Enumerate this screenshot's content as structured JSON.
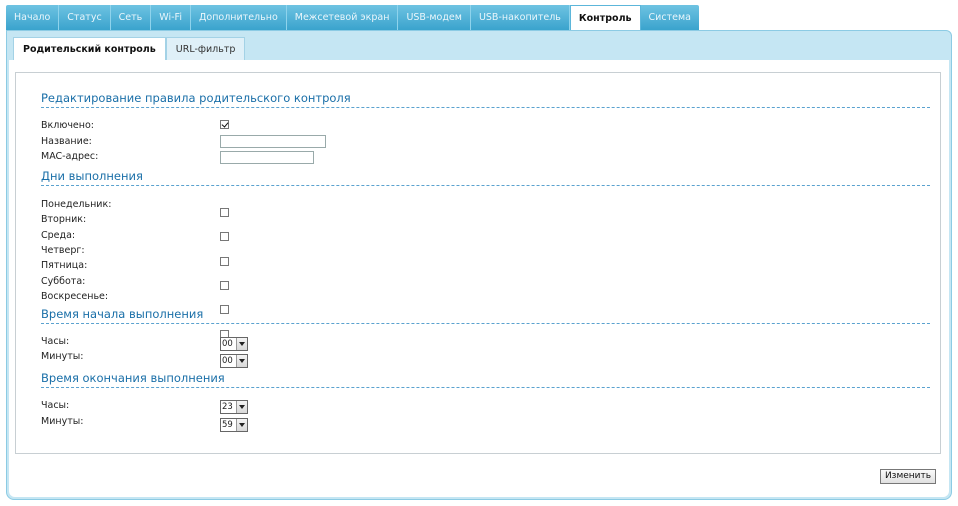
{
  "top_tabs": [
    {
      "label": "Начало"
    },
    {
      "label": "Статус"
    },
    {
      "label": "Сеть"
    },
    {
      "label": "Wi-Fi"
    },
    {
      "label": "Дополнительно"
    },
    {
      "label": "Межсетевой экран"
    },
    {
      "label": "USB-модем"
    },
    {
      "label": "USB-накопитель"
    },
    {
      "label": "Контроль"
    },
    {
      "label": "Система"
    }
  ],
  "active_top_tab": "Контроль",
  "sub_tabs": [
    {
      "label": "Родительский контроль"
    },
    {
      "label": "URL-фильтр"
    }
  ],
  "active_sub_tab": "Родительский контроль",
  "edit_section": {
    "title": "Редактирование правила родительского контроля",
    "enabled_label": "Включено:",
    "enabled": true,
    "name_label": "Название:",
    "name_value": "",
    "mac_label": "MAC-адрес:",
    "mac_value": ""
  },
  "days_section": {
    "title": "Дни выполнения",
    "days": [
      {
        "label": "Понедельник:",
        "checked": false
      },
      {
        "label": "Вторник:",
        "checked": false
      },
      {
        "label": "Среда:",
        "checked": false
      },
      {
        "label": "Четверг:",
        "checked": false
      },
      {
        "label": "Пятница:",
        "checked": false
      },
      {
        "label": "Суббота:",
        "checked": false
      },
      {
        "label": "Воскресенье:",
        "checked": false
      }
    ]
  },
  "start_section": {
    "title": "Время начала выполнения",
    "hours_label": "Часы:",
    "hours_value": "00",
    "minutes_label": "Минуты:",
    "minutes_value": "00"
  },
  "end_section": {
    "title": "Время окончания выполнения",
    "hours_label": "Часы:",
    "hours_value": "23",
    "minutes_label": "Минуты:",
    "minutes_value": "59"
  },
  "submit_label": "Изменить",
  "colors": {
    "tab_bar": "#3aa3cd",
    "frame": "#c5e6f3",
    "section_title": "#1a6fa8"
  }
}
